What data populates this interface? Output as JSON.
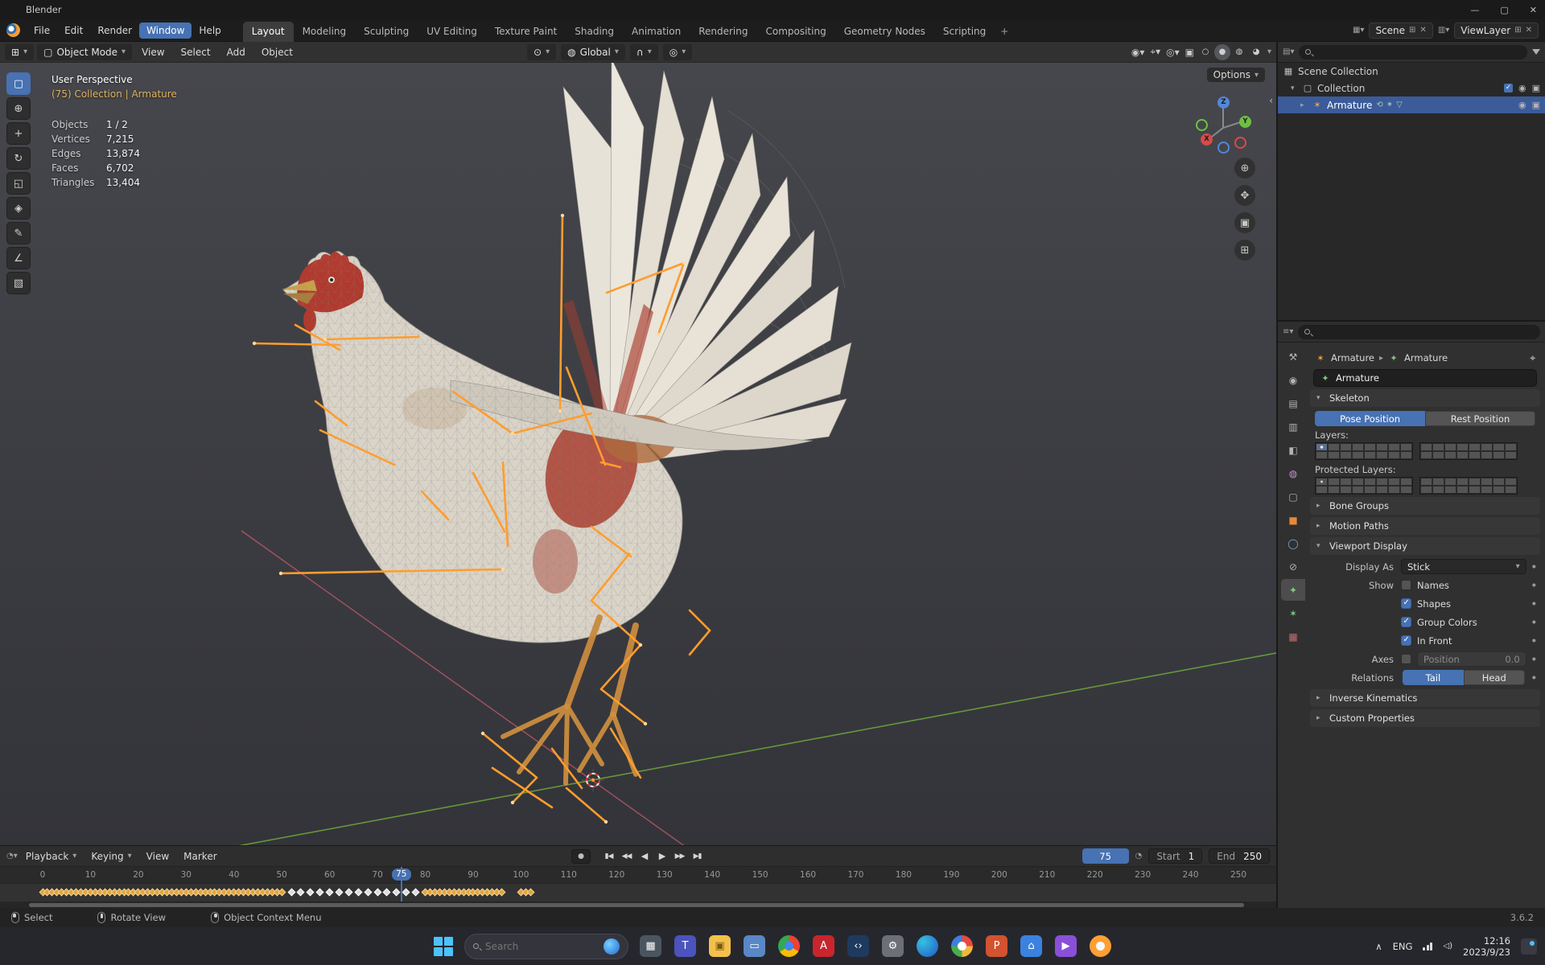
{
  "window": {
    "title": "Blender"
  },
  "menubar": {
    "menus": [
      "File",
      "Edit",
      "Render",
      "Window",
      "Help"
    ],
    "workspaces": [
      "Layout",
      "Modeling",
      "Sculpting",
      "UV Editing",
      "Texture Paint",
      "Shading",
      "Animation",
      "Rendering",
      "Compositing",
      "Geometry Nodes",
      "Scripting",
      "+"
    ],
    "scene": "Scene",
    "viewlayer": "ViewLayer"
  },
  "viewport": {
    "header": {
      "mode": "Object Mode",
      "menu_view": "View",
      "menu_select": "Select",
      "menu_add": "Add",
      "menu_object": "Object",
      "orientation": "Global",
      "options": "Options"
    },
    "overlay": {
      "view_name": "User Perspective",
      "context": "(75) Collection | Armature",
      "stats": [
        {
          "label": "Objects",
          "value": "1 / 2"
        },
        {
          "label": "Vertices",
          "value": "7,215"
        },
        {
          "label": "Edges",
          "value": "13,874"
        },
        {
          "label": "Faces",
          "value": "6,702"
        },
        {
          "label": "Triangles",
          "value": "13,404"
        }
      ]
    },
    "gizmo": {
      "x": "X",
      "y": "Y",
      "z": "Z"
    }
  },
  "outliner": {
    "rows": [
      {
        "label": "Scene Collection"
      },
      {
        "label": "Collection"
      },
      {
        "label": "Armature"
      }
    ]
  },
  "properties": {
    "tabs": [
      "tool",
      "render",
      "output",
      "view-layer",
      "scene",
      "world",
      "collection",
      "object",
      "physics",
      "constraints",
      "object-data",
      "bone",
      "texture"
    ],
    "active_tab": "object-data",
    "breadcrumb": {
      "object": "Armature",
      "data": "Armature"
    },
    "name": "Armature",
    "skeleton": {
      "title": "Skeleton",
      "pose": "Pose Position",
      "rest": "Rest Position",
      "active": "Pose Position",
      "layers": "Layers:",
      "protected": "Protected Layers:"
    },
    "bone_groups": "Bone Groups",
    "motion_paths": "Motion Paths",
    "viewport_display": {
      "title": "Viewport Display",
      "display_as_label": "Display As",
      "display_as": "Stick",
      "show_label": "Show",
      "toggles": [
        {
          "label": "Names",
          "checked": false
        },
        {
          "label": "Shapes",
          "checked": true
        },
        {
          "label": "Group Colors",
          "checked": true
        },
        {
          "label": "In Front",
          "checked": true
        }
      ],
      "axes_label": "Axes",
      "position_label": "Position",
      "position_value": "0.0",
      "relations_label": "Relations",
      "tail": "Tail",
      "head": "Head",
      "relations_active": "Tail"
    },
    "inverse_kinematics": "Inverse Kinematics",
    "custom_properties": "Custom Properties"
  },
  "timeline": {
    "menus": [
      "Playback",
      "Keying",
      "View",
      "Marker"
    ],
    "current_frame": "75",
    "start_label": "Start",
    "start": "1",
    "end_label": "End",
    "end": "250",
    "frame_min": 0,
    "frame_max": 250,
    "tick_step": 10,
    "keyframe_ranges": [
      [
        0,
        50,
        1
      ],
      [
        52,
        78,
        2
      ],
      [
        80,
        96,
        1
      ],
      [
        100,
        102,
        1
      ]
    ]
  },
  "statusbar": {
    "select": "Select",
    "rotate": "Rotate View",
    "context_menu": "Object Context Menu",
    "version": "3.6.2"
  },
  "taskbar": {
    "search": "Search",
    "apps": [
      "task-view",
      "teams",
      "file-explorer",
      "monitor",
      "chrome",
      "adobe",
      "code",
      "settings",
      "edge",
      "photos",
      "powerpoint",
      "store",
      "media",
      "blender"
    ],
    "lang": "ENG",
    "time": "12:16",
    "date": "2023/9/23"
  },
  "colors": {
    "accent": "#4772b3",
    "bone": "#ff9d2e",
    "selection": "#3b5b9a"
  }
}
